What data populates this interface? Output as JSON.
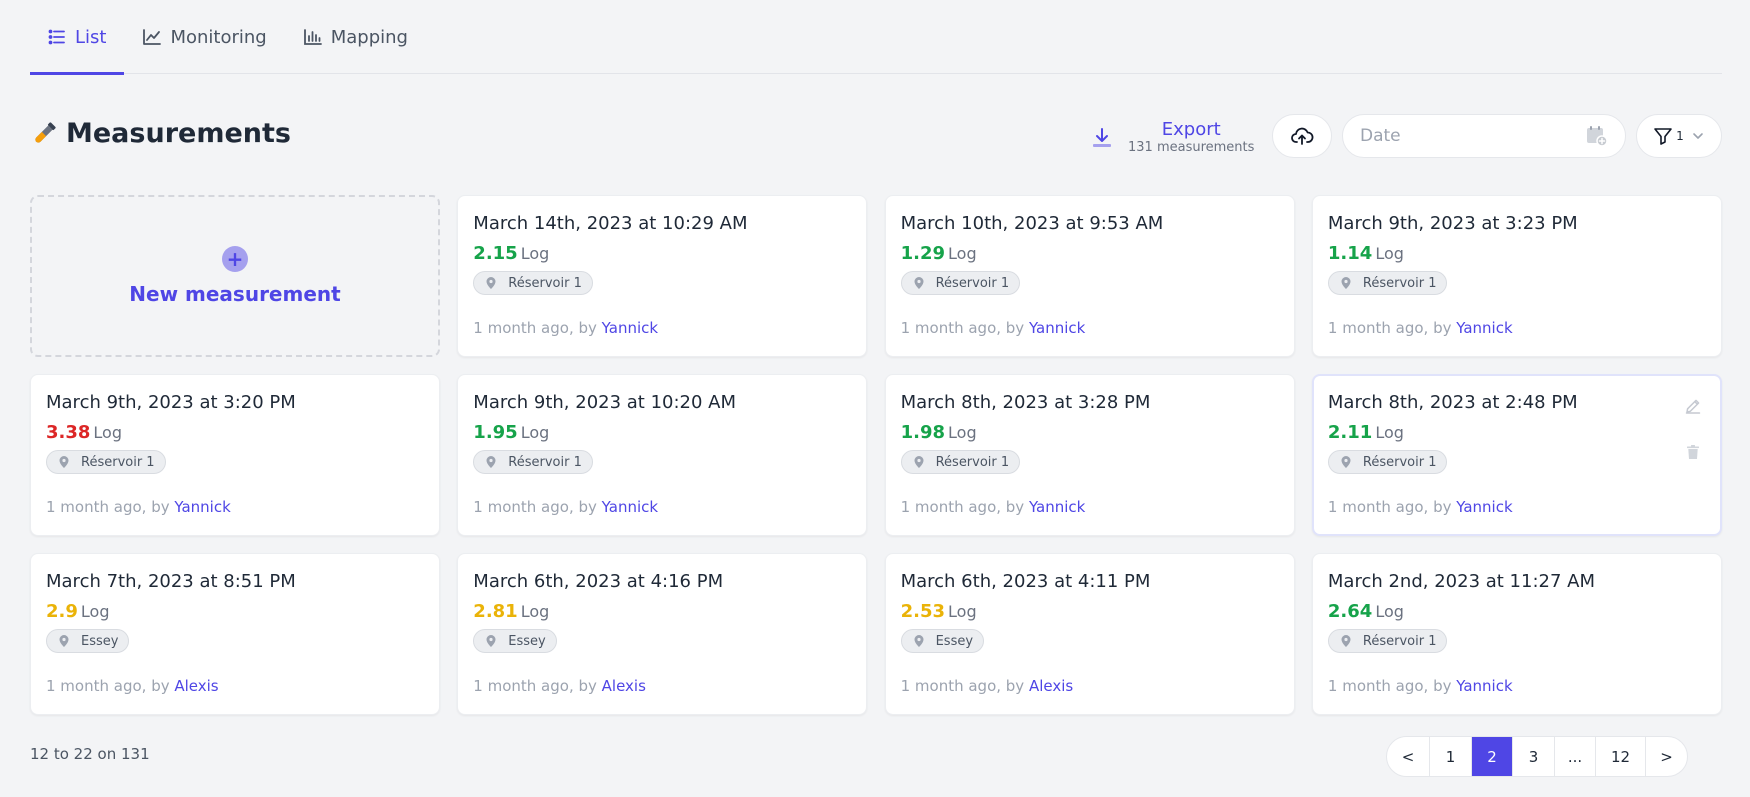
{
  "tabs": [
    {
      "label": "List",
      "icon": "list-icon",
      "active": true
    },
    {
      "label": "Monitoring",
      "icon": "line-chart-icon",
      "active": false
    },
    {
      "label": "Mapping",
      "icon": "bar-chart-icon",
      "active": false
    }
  ],
  "header": {
    "title": "Measurements",
    "title_icon": "test-tube-icon",
    "export_label": "Export",
    "export_sub": "131 measurements",
    "date_placeholder": "Date",
    "filter_count": "1"
  },
  "new_measurement_label": "New measurement",
  "unit": "Log",
  "by_prefix": "1 month ago, by ",
  "cards": [
    {
      "date": "March 14th, 2023 at 10:29 AM",
      "value": "2.15",
      "status": "green",
      "location": "Réservoir 1",
      "author": "Yannick"
    },
    {
      "date": "March 10th, 2023 at 9:53 AM",
      "value": "1.29",
      "status": "green",
      "location": "Réservoir 1",
      "author": "Yannick"
    },
    {
      "date": "March 9th, 2023 at 3:23 PM",
      "value": "1.14",
      "status": "green",
      "location": "Réservoir 1",
      "author": "Yannick"
    },
    {
      "date": "March 9th, 2023 at 3:20 PM",
      "value": "3.38",
      "status": "red",
      "location": "Réservoir 1",
      "author": "Yannick"
    },
    {
      "date": "March 9th, 2023 at 10:20 AM",
      "value": "1.95",
      "status": "green",
      "location": "Réservoir 1",
      "author": "Yannick"
    },
    {
      "date": "March 8th, 2023 at 3:28 PM",
      "value": "1.98",
      "status": "green",
      "location": "Réservoir 1",
      "author": "Yannick"
    },
    {
      "date": "March 8th, 2023 at 2:48 PM",
      "value": "2.11",
      "status": "green",
      "location": "Réservoir 1",
      "author": "Yannick",
      "hover": true
    },
    {
      "date": "March 7th, 2023 at 8:51 PM",
      "value": "2.9",
      "status": "amber",
      "location": "Essey",
      "author": "Alexis"
    },
    {
      "date": "March 6th, 2023 at 4:16 PM",
      "value": "2.81",
      "status": "amber",
      "location": "Essey",
      "author": "Alexis"
    },
    {
      "date": "March 6th, 2023 at 4:11 PM",
      "value": "2.53",
      "status": "amber",
      "location": "Essey",
      "author": "Alexis"
    },
    {
      "date": "March 2nd, 2023 at 11:27 AM",
      "value": "2.64",
      "status": "green",
      "location": "Réservoir 1",
      "author": "Yannick"
    }
  ],
  "footer": {
    "range_text": "12 to 22 on 131",
    "pages": [
      {
        "label": "<",
        "name": "page-prev"
      },
      {
        "label": "1",
        "name": "page-1"
      },
      {
        "label": "2",
        "name": "page-2",
        "active": true
      },
      {
        "label": "3",
        "name": "page-3"
      },
      {
        "label": "...",
        "name": "page-ellipsis"
      },
      {
        "label": "12",
        "name": "page-12"
      },
      {
        "label": ">",
        "name": "page-next"
      }
    ]
  },
  "colors": {
    "accent": "#4f46e5",
    "good": "#16a34a",
    "bad": "#dc2626",
    "warn": "#eab308"
  }
}
